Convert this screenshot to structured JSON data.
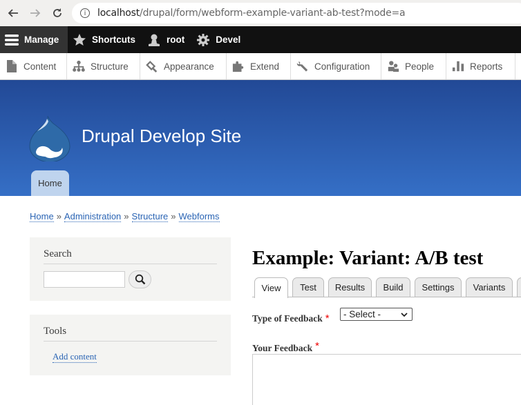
{
  "browser": {
    "url_host": "localhost",
    "url_path": "/drupal/form/webform-example-variant-ab-test?mode=a"
  },
  "toolbar": {
    "items": [
      {
        "label": "Manage",
        "icon": "menu-icon"
      },
      {
        "label": "Shortcuts",
        "icon": "star-icon"
      },
      {
        "label": "root",
        "icon": "user-icon"
      },
      {
        "label": "Devel",
        "icon": "gear-icon"
      }
    ]
  },
  "tray": {
    "items": [
      {
        "label": "Content",
        "icon": "file-icon"
      },
      {
        "label": "Structure",
        "icon": "sitemap-icon"
      },
      {
        "label": "Appearance",
        "icon": "paintbrush-icon"
      },
      {
        "label": "Extend",
        "icon": "puzzle-icon"
      },
      {
        "label": "Configuration",
        "icon": "wrench-icon"
      },
      {
        "label": "People",
        "icon": "people-icon"
      },
      {
        "label": "Reports",
        "icon": "bar-chart-icon"
      }
    ]
  },
  "header": {
    "site_name": "Drupal Develop Site",
    "home_tab": "Home",
    "gradient_top": "#224996",
    "gradient_bottom": "#356fc6"
  },
  "breadcrumb": {
    "items": [
      "Home",
      "Administration",
      "Structure",
      "Webforms"
    ],
    "separator": "»"
  },
  "sidebar": {
    "search": {
      "title": "Search",
      "value": ""
    },
    "tools": {
      "title": "Tools",
      "link": "Add content"
    }
  },
  "main": {
    "title": "Example: Variant: A/B test",
    "tabs": [
      "View",
      "Test",
      "Results",
      "Build",
      "Settings",
      "Variants"
    ],
    "active_tab": "View",
    "form": {
      "type_label": "Type of Feedback",
      "type_value": "- Select -",
      "feedback_label": "Your Feedback",
      "required_mark": "*",
      "feedback_value": ""
    }
  }
}
